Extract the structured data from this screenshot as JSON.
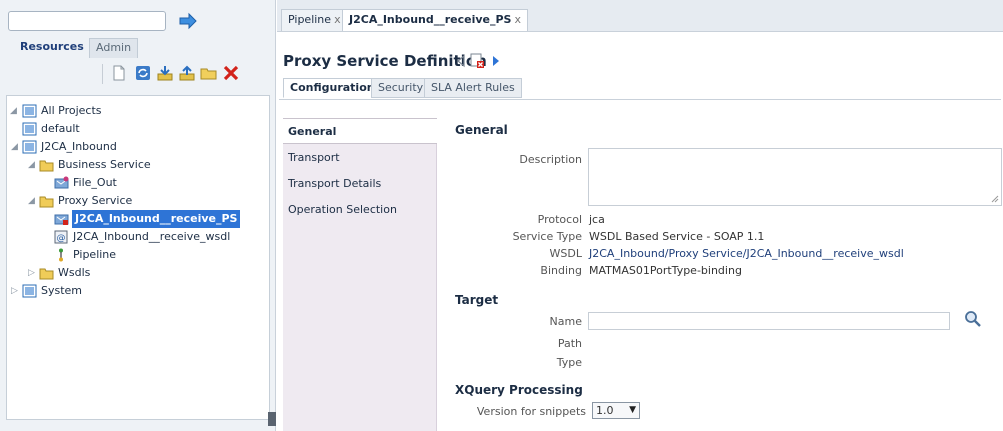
{
  "left": {
    "search_value": "",
    "tabs": [
      "Resources",
      "Admin"
    ],
    "toolbar_icons": [
      "new-doc-icon",
      "refresh-icon",
      "import-icon",
      "export-icon",
      "open-folder-icon",
      "delete-icon"
    ],
    "tree": [
      {
        "label": "All Projects",
        "icon": "projects-icon"
      },
      {
        "label": "default",
        "icon": "project-icon"
      },
      {
        "label": "J2CA_Inbound",
        "icon": "project-icon"
      },
      {
        "label": "Business Service",
        "icon": "folder-icon"
      },
      {
        "label": "File_Out",
        "icon": "business-service-icon"
      },
      {
        "label": "Proxy Service",
        "icon": "folder-icon"
      },
      {
        "label": "J2CA_Inbound__receive_PS",
        "icon": "proxy-service-icon"
      },
      {
        "label": "J2CA_Inbound__receive_wsdl",
        "icon": "wsdl-icon"
      },
      {
        "label": "Pipeline",
        "icon": "pipeline-icon"
      },
      {
        "label": "Wsdls",
        "icon": "folder-icon"
      },
      {
        "label": "System",
        "icon": "project-icon"
      }
    ]
  },
  "doc_tabs": [
    {
      "label": "Pipeline",
      "close": "x"
    },
    {
      "label": "J2CA_Inbound__receive_PS",
      "close": "x"
    }
  ],
  "definition": {
    "title": "Proxy Service Definition",
    "tabs": [
      "Configuration",
      "Security",
      "SLA Alert Rules"
    ],
    "side_nav": [
      "General",
      "Transport",
      "Transport Details",
      "Operation Selection"
    ]
  },
  "general": {
    "heading": "General",
    "description_label": "Description",
    "description_value": "",
    "protocol_label": "Protocol",
    "protocol_value": "jca",
    "service_type_label": "Service Type",
    "service_type_value": "WSDL Based Service - SOAP 1.1",
    "wsdl_label": "WSDL",
    "wsdl_value": "J2CA_Inbound/Proxy Service/J2CA_Inbound__receive_wsdl",
    "binding_label": "Binding",
    "binding_value": "MATMAS01PortType-binding"
  },
  "target": {
    "heading": "Target",
    "name_label": "Name",
    "name_value": "",
    "path_label": "Path",
    "type_label": "Type"
  },
  "xquery": {
    "heading": "XQuery Processing",
    "version_label": "Version for snippets",
    "version_value": "1.0"
  },
  "colors": {
    "selection": "#2e74d6",
    "link": "#1f3f7a",
    "side_nav_bg": "#efeaf1"
  }
}
